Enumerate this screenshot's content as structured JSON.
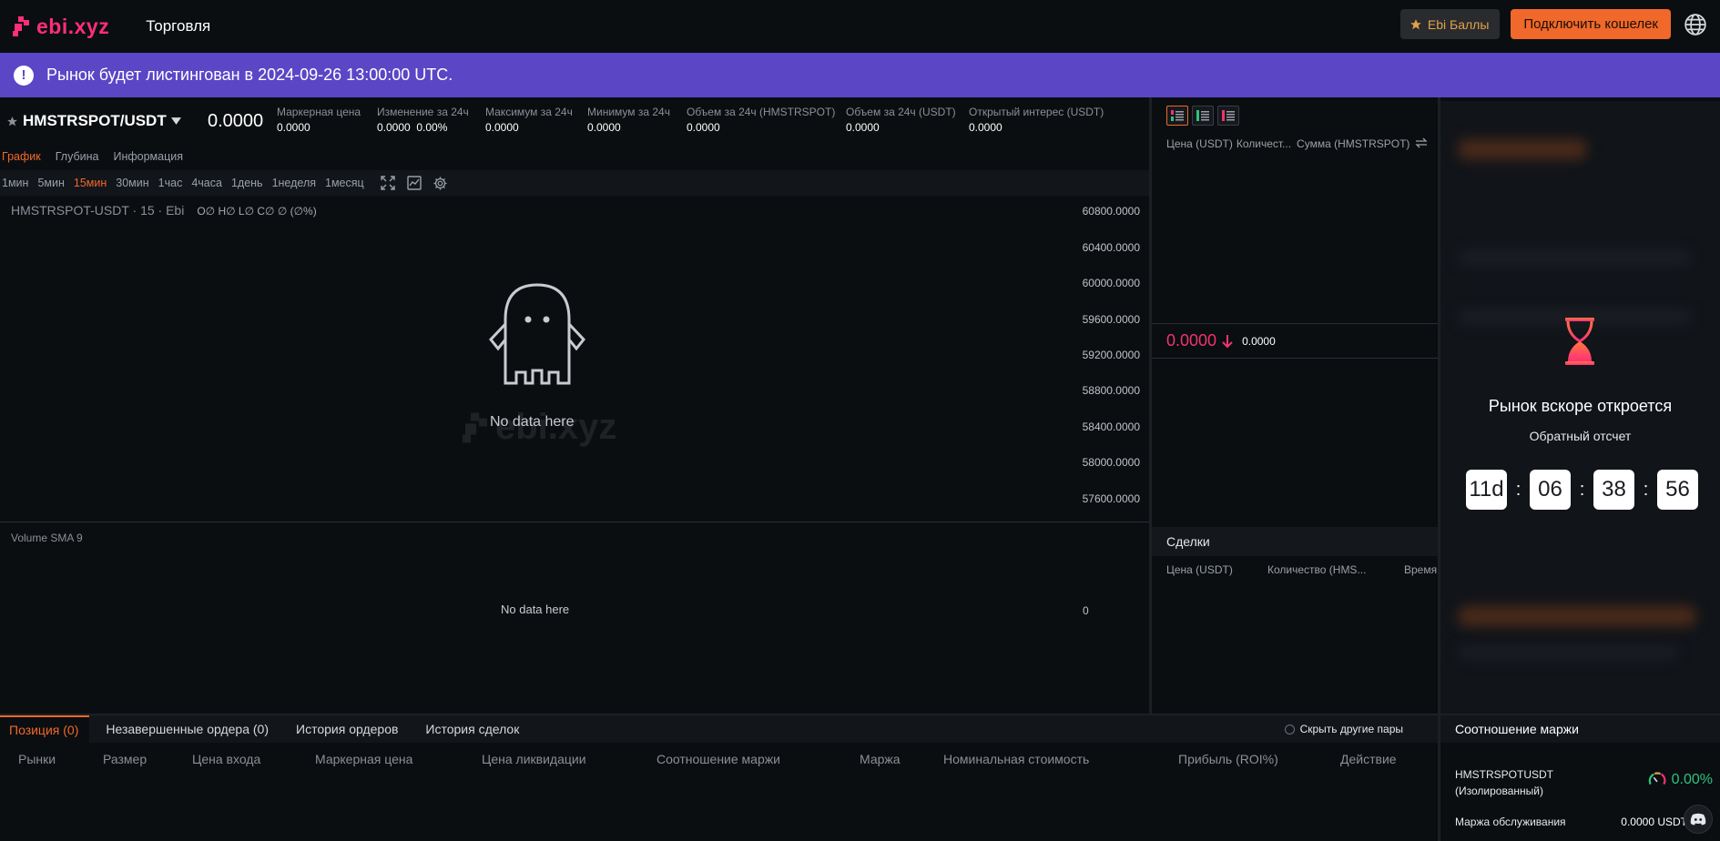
{
  "nav": {
    "logo_text": "ebi.xyz",
    "trade_link": "Торговля",
    "points_label": "Ebi Баллы",
    "connect_label": "Подключить кошелек",
    "icons": [
      "logo-icon",
      "star-icon",
      "globe-icon"
    ]
  },
  "banner": {
    "icon": "!",
    "text": "Рынок будет листингован в 2024-09-26 13:00:00 UTC."
  },
  "ticker": {
    "pair": "HMSTRSPOT/USDT",
    "last_price": "0.0000",
    "stats": [
      {
        "label": "Маркерная цена",
        "value": "0.0000"
      },
      {
        "label": "Изменение за 24ч",
        "value": "0.0000",
        "value2": "0.00%"
      },
      {
        "label": "Максимум за 24ч",
        "value": "0.0000"
      },
      {
        "label": "Минимум за 24ч",
        "value": "0.0000"
      },
      {
        "label": "Объем за 24ч (HMSTRSPOT)",
        "value": "0.0000"
      },
      {
        "label": "Объем за 24ч (USDT)",
        "value": "0.0000"
      },
      {
        "label": "Открытый интерес (USDT)",
        "value": "0.0000"
      }
    ]
  },
  "chart_tabs": {
    "chart": "График",
    "depth": "Глубина",
    "info": "Информация"
  },
  "timeframes": [
    "1мин",
    "5мин",
    "15мин",
    "30мин",
    "1час",
    "4часа",
    "1день",
    "1неделя",
    "1месяц"
  ],
  "active_timeframe": "15мин",
  "chart": {
    "legend": "HMSTRSPOT-USDT · 15 · Ebi",
    "ohlc": "O∅ H∅ L∅ C∅ ∅ (∅%)",
    "no_data": "No data here",
    "watermark": "ebi.xyz",
    "y_ticks": [
      "60800.0000",
      "60400.0000",
      "60000.0000",
      "59600.0000",
      "59200.0000",
      "58800.0000",
      "58400.0000",
      "58000.0000",
      "57600.0000"
    ],
    "volume_label": "Volume SMA 9",
    "volume_no_data": "No data here",
    "volume_tick": "0"
  },
  "orderbook": {
    "col_price": "Цена (USDT)",
    "col_qty": "Количест...",
    "col_sum": "Сумма (HMSTRSPOT)",
    "mid_price": "0.0000",
    "mark_price": "0.0000",
    "down_color": "#f0346e"
  },
  "trades": {
    "title": "Сделки",
    "col_price": "Цена (USDT)",
    "col_qty": "Количество (HMS...",
    "col_time": "Время"
  },
  "countdown_panel": {
    "title": "Рынок вскоре откроется",
    "subtitle": "Обратный отсчет",
    "days": "11d",
    "hours": "06",
    "minutes": "38",
    "seconds": "56",
    "sep": ":"
  },
  "positions": {
    "tabs": [
      "Позиция (0)",
      "Незавершенные ордера (0)",
      "История ордеров",
      "История сделок"
    ],
    "hide_pairs": "Скрыть другие пары",
    "columns": [
      "Рынки",
      "Размер",
      "Цена входа",
      "Маркерная цена",
      "Цена ликвидации",
      "Соотношение маржи",
      "Маржа",
      "Номинальная стоимость",
      "Прибыль (ROI%)",
      "Действие"
    ]
  },
  "margin": {
    "title": "Соотношение маржи",
    "pair": "HMSTRSPOTUSDT",
    "mode": "(Изолированный)",
    "ratio": "0.00%",
    "maintenance_label": "Маржа обслуживания",
    "maintenance_value": "0.0000 USDT"
  },
  "colors": {
    "accent": "#f0682a",
    "brand": "#ff2e7a",
    "banner": "#5b46c6",
    "up": "#2ec27e",
    "down": "#f0346e"
  }
}
